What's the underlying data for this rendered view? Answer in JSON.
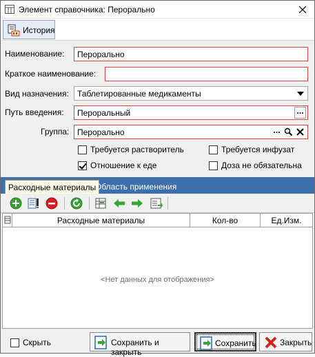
{
  "window": {
    "title": "Элемент справочника: Перорально",
    "close_icon": "close-icon",
    "app_icon": "table-icon"
  },
  "toolbar": {
    "history_label": "История",
    "history_icon": "history-icon"
  },
  "form": {
    "name_label": "Наименование:",
    "name_value": "Перорально",
    "short_name_label": "Краткое наименование:",
    "short_name_value": "",
    "purpose_label": "Вид назначения:",
    "purpose_value": "Таблетированные медикаменты",
    "route_label": "Путь введения:",
    "route_value": "Пероральный",
    "group_label": "Группа:",
    "group_value": "Перорально"
  },
  "checkboxes": {
    "solvent": {
      "label": "Требуется растворитель",
      "checked": false
    },
    "infusion": {
      "label": "Требуется инфузат",
      "checked": false
    },
    "food": {
      "label": "Отношение к еде",
      "checked": true
    },
    "dose_optional": {
      "label": "Доза не обязательна",
      "checked": false
    }
  },
  "tabs": {
    "consumables": "Расходные материалы",
    "application_area": "Область применения"
  },
  "grid": {
    "columns": [
      "Расходные материалы",
      "Кол-во",
      "Ед.Изм."
    ],
    "rows": [],
    "empty_text": "<Нет данных для отображения>"
  },
  "footer": {
    "hide_label": "Скрыть",
    "hide_checked": false,
    "save_close_label": "Сохранить и закрыть",
    "save_label": "Сохранить",
    "close_label": "Закрыть"
  },
  "colors": {
    "tab_strip": "#3e6fad",
    "required_border": "#e04040",
    "add_green": "#3aa335",
    "delete_red": "#d42020"
  }
}
